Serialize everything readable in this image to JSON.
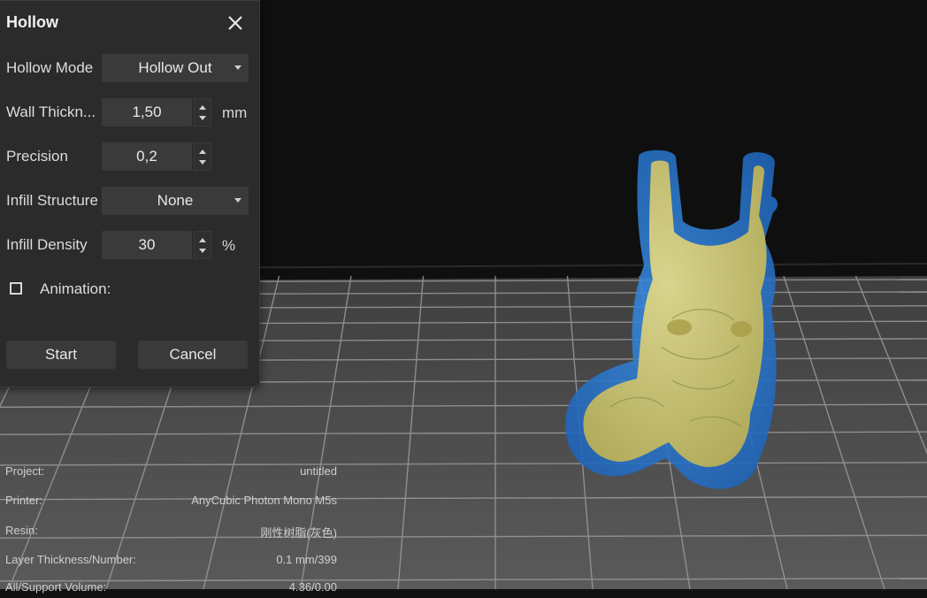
{
  "dialog": {
    "title": "Hollow",
    "fields": {
      "hollow_mode": {
        "label": "Hollow Mode",
        "value": "Hollow Out"
      },
      "wall_thickness": {
        "label": "Wall Thickn...",
        "value": "1,50",
        "unit": "mm"
      },
      "precision": {
        "label": "Precision",
        "value": "0,2"
      },
      "infill_structure": {
        "label": "Infill Structure",
        "value": "None"
      },
      "infill_density": {
        "label": "Infill Density",
        "value": "30",
        "unit": "%"
      }
    },
    "animation": {
      "label": "Animation:",
      "checked": false
    },
    "start_label": "Start",
    "cancel_label": "Cancel"
  },
  "info": {
    "project": {
      "label": "Project:",
      "value": "untitled"
    },
    "printer": {
      "label": "Printer:",
      "value": "AnyCubic Photon Mono M5s"
    },
    "resin": {
      "label": "Resin:",
      "value": "刚性树脂(灰色)"
    },
    "layer": {
      "label": "Layer Thickness/Number:",
      "value": "0.1 mm/399"
    },
    "volume": {
      "label": "All/Support Volume:",
      "value": "4.36/0.00"
    }
  },
  "colors": {
    "viewport_bg": "#0f0f0f",
    "plate": "#4b4b4b",
    "grid_line": "#9a9a9a",
    "model_shell": "#2f7fd6",
    "model_core": "#cfc36a"
  }
}
